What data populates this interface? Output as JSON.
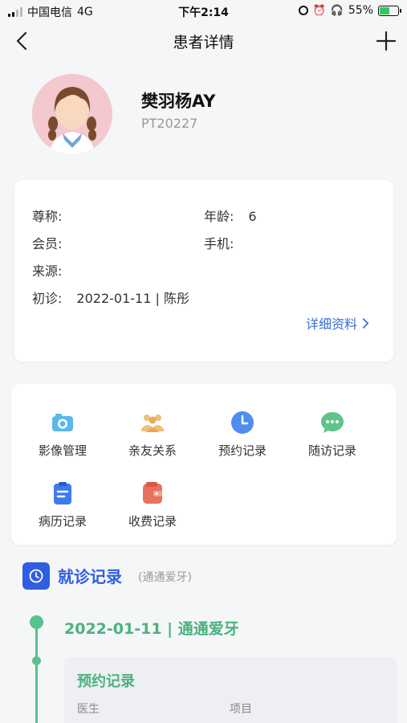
{
  "status_bar": {
    "carrier": "中国电信",
    "network": "4G",
    "time": "下午2:14",
    "battery": "55%"
  },
  "nav": {
    "title": "患者详情",
    "back_icon": "chevron-left-icon",
    "add_icon": "plus-icon"
  },
  "patient": {
    "name": "樊羽杨AY",
    "id": "PT20227"
  },
  "info": {
    "nickname_label": "尊称:",
    "nickname_value": "",
    "age_label": "年龄:",
    "age_value": "6",
    "member_label": "会员:",
    "member_value": "",
    "phone_label": "手机:",
    "phone_value": "",
    "source_label": "来源:",
    "source_value": "",
    "first_visit_label": "初诊:",
    "first_visit_value": "2022-01-11 | 陈彤",
    "detail_link": "详细资料"
  },
  "functions": [
    {
      "label": "影像管理",
      "icon": "camera-icon",
      "color": "#5ab9e8"
    },
    {
      "label": "亲友关系",
      "icon": "people-icon",
      "color": "#f0bf7a"
    },
    {
      "label": "预约记录",
      "icon": "clock-icon",
      "color": "#4f8df0"
    },
    {
      "label": "随访记录",
      "icon": "chat-icon",
      "color": "#5ec48a"
    },
    {
      "label": "病历记录",
      "icon": "clipboard-icon",
      "color": "#3f7af0"
    },
    {
      "label": "收费记录",
      "icon": "wallet-icon",
      "color": "#e8705f"
    }
  ],
  "visits": {
    "title": "就诊记录",
    "subtitle": "(通通爱牙)",
    "entry_date": "2022-01-11 | 通通爱牙",
    "appointment_title": "预约记录",
    "col_doctor": "医生",
    "col_project": "项目"
  },
  "colors": {
    "accent_blue": "#2f5fe0",
    "link_blue": "#3a6fd8",
    "timeline_green": "#5ac18e"
  }
}
